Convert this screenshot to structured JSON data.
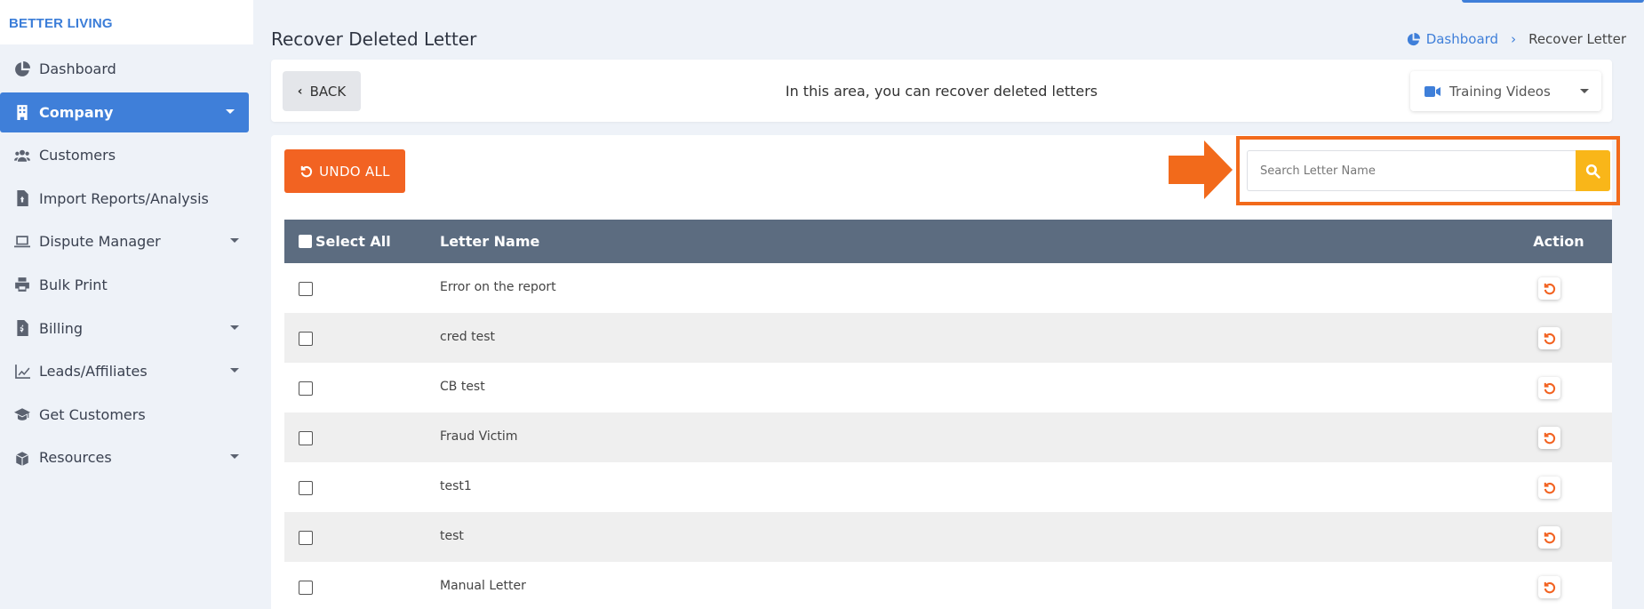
{
  "brand": {
    "name": "BETTER LIVING"
  },
  "sidebar": {
    "items": [
      {
        "label": "Dashboard",
        "icon": "pie-chart-icon",
        "active": false,
        "has_caret": false
      },
      {
        "label": "Company",
        "icon": "building-icon",
        "active": true,
        "has_caret": true
      },
      {
        "label": "Customers",
        "icon": "users-icon",
        "active": false,
        "has_caret": false
      },
      {
        "label": "Import Reports/Analysis",
        "icon": "file-import-icon",
        "active": false,
        "has_caret": false
      },
      {
        "label": "Dispute Manager",
        "icon": "laptop-icon",
        "active": false,
        "has_caret": true
      },
      {
        "label": "Bulk Print",
        "icon": "printer-icon",
        "active": false,
        "has_caret": false
      },
      {
        "label": "Billing",
        "icon": "invoice-icon",
        "active": false,
        "has_caret": true
      },
      {
        "label": "Leads/Affiliates",
        "icon": "chart-line-icon",
        "active": false,
        "has_caret": true
      },
      {
        "label": "Get Customers",
        "icon": "graduation-cap-icon",
        "active": false,
        "has_caret": false
      },
      {
        "label": "Resources",
        "icon": "box-icon",
        "active": false,
        "has_caret": true
      }
    ]
  },
  "header": {
    "title": "Recover Deleted Letter",
    "breadcrumb": {
      "home": "Dashboard",
      "current": "Recover Letter"
    }
  },
  "info_bar": {
    "back_label": "BACK",
    "message": "In this area, you can recover deleted letters",
    "training_label": "Training Videos"
  },
  "toolbar": {
    "undo_all_label": "UNDO ALL",
    "search_placeholder": "Search Letter Name"
  },
  "table": {
    "headers": {
      "select_all": "Select All",
      "letter_name": "Letter Name",
      "action": "Action"
    },
    "rows": [
      {
        "name": "Error on the report"
      },
      {
        "name": "cred test"
      },
      {
        "name": "CB test"
      },
      {
        "name": "Fraud Victim"
      },
      {
        "name": "test1"
      },
      {
        "name": "test"
      },
      {
        "name": "Manual Letter"
      }
    ]
  },
  "colors": {
    "primary": "#3f7fd9",
    "accent_orange": "#f26322",
    "search_button": "#f9b619",
    "table_header": "#5c6c80"
  }
}
